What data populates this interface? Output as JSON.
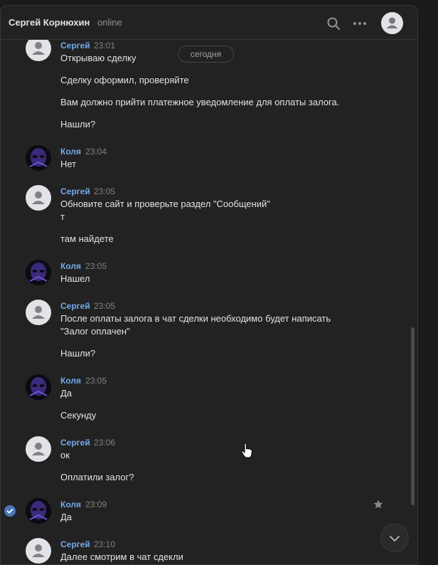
{
  "header": {
    "contact_name": "Сергей Корнюхин",
    "status": "online",
    "search_icon": "search-icon",
    "more_icon": "more-icon"
  },
  "feed": {
    "date_separator": "сегодня"
  },
  "messages": [
    {
      "author": "Сергей",
      "time": "23:01",
      "lines": [
        "Открываю сделку",
        "Сделку оформил, проверяйте",
        "Вам должно прийти платежное уведомление для оплаты залога.",
        "Нашли?"
      ]
    },
    {
      "author": "Коля",
      "time": "23:04",
      "lines": [
        "Нет"
      ]
    },
    {
      "author": "Сергей",
      "time": "23:05",
      "lines": [
        "Обновите сайт и проверьте раздел \"Сообщений\"",
        "т",
        "там найдете"
      ]
    },
    {
      "author": "Коля",
      "time": "23:05",
      "lines": [
        "Нашел"
      ]
    },
    {
      "author": "Сергей",
      "time": "23:05",
      "lines": [
        "После оплаты залога в чат сделки необходимо будет написать",
        "\"Залог оплачен\"",
        "Нашли?"
      ]
    },
    {
      "author": "Коля",
      "time": "23:05",
      "lines": [
        "Да",
        "Секунду"
      ]
    },
    {
      "author": "Сергей",
      "time": "23:06",
      "lines": [
        "ок",
        "Оплатили залог?"
      ]
    },
    {
      "author": "Коля",
      "time": "23:09",
      "lines": [
        "Да"
      ]
    },
    {
      "author": "Сергей",
      "time": "23:10",
      "lines": [
        "Далее смотрим в чат сдекли"
      ]
    }
  ],
  "colors": {
    "accent": "#71aaeb",
    "background": "#222222",
    "text": "#e1e3e6",
    "muted": "#828282"
  }
}
